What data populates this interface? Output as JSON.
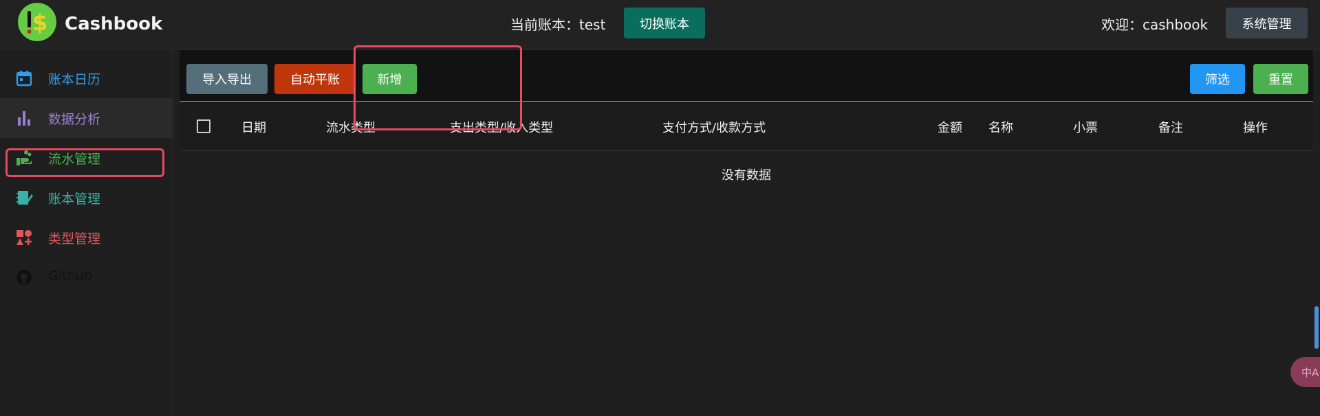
{
  "app": {
    "name": "Cashbook"
  },
  "header": {
    "current_book_label": "当前账本：test",
    "switch_button": "切换账本",
    "welcome": "欢迎：cashbook",
    "system_button": "系统管理"
  },
  "sidebar": {
    "items": [
      {
        "label": "账本日历",
        "icon": "calendar-icon",
        "color": "#2e9cf2"
      },
      {
        "label": "数据分析",
        "icon": "bar-chart-icon",
        "color": "#9a7fd1"
      },
      {
        "label": "流水管理",
        "icon": "hand-coins-icon",
        "color": "#4caf50"
      },
      {
        "label": "账本管理",
        "icon": "notebook-icon",
        "color": "#38b2a8"
      },
      {
        "label": "类型管理",
        "icon": "shapes-icon",
        "color": "#e0575b"
      },
      {
        "label": "Github",
        "icon": "github-icon",
        "color": "#111111"
      }
    ]
  },
  "toolbar": {
    "import_export": "导入导出",
    "auto_balance": "自动平账",
    "add": "新增",
    "filter": "筛选",
    "reset": "重置"
  },
  "table": {
    "columns": [
      "日期",
      "流水类型",
      "支出类型/收入类型",
      "支付方式/收款方式",
      "金额",
      "名称",
      "小票",
      "备注",
      "操作"
    ],
    "empty_text": "没有数据"
  },
  "colors": {
    "import_export": "#546e7a",
    "auto_balance": "#c0360c",
    "add": "#4caf50",
    "filter": "#2196f3",
    "reset": "#4caf50",
    "highlight": "#e84a5f"
  },
  "floating": {
    "translate_label": "中A"
  }
}
